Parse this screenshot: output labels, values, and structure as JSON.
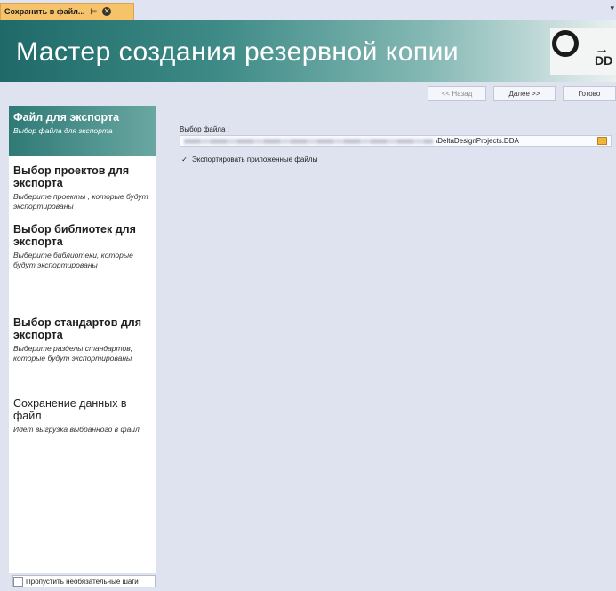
{
  "tab": {
    "label": "Сохранить в файл...",
    "pin": "⊨",
    "close": "✕",
    "menu": "▾"
  },
  "banner": {
    "title": "Мастер создания резервной копии",
    "logo_text": "DD",
    "logo_arrow": "→"
  },
  "nav": {
    "back": "<< Назад",
    "next": "Далее >>",
    "done": "Готово"
  },
  "steps": [
    {
      "title": "Файл для экспорта",
      "subtitle": "Выбор файла для экспорта",
      "active": true
    },
    {
      "title": "Выбор проектов для экспорта",
      "subtitle": "Выберите проекты , которые будут экспортированы"
    },
    {
      "title": "Выбор библиотек для экспорта",
      "subtitle": "Выберите библиотеки, которые будут экспортированы"
    },
    {
      "title": "Выбор стандартов для экспорта",
      "subtitle": "Выберите разделы стандартов, которые будут экспортированы"
    },
    {
      "title": "Сохранение данных в файл",
      "subtitle": "Идет выгрузка выбранного в файл"
    }
  ],
  "skip": {
    "label": "Пропустить необязательные шаги"
  },
  "form": {
    "file_label": "Выбор файла :",
    "file_value": "\\DeltaDesignProjects.DDA",
    "attach_label": "Экспортировать приложенные файлы",
    "attach_checked": "✓"
  },
  "colors": {
    "accent": "#2f7a76",
    "tab": "#f6c36a",
    "background": "#dfe3f0"
  }
}
